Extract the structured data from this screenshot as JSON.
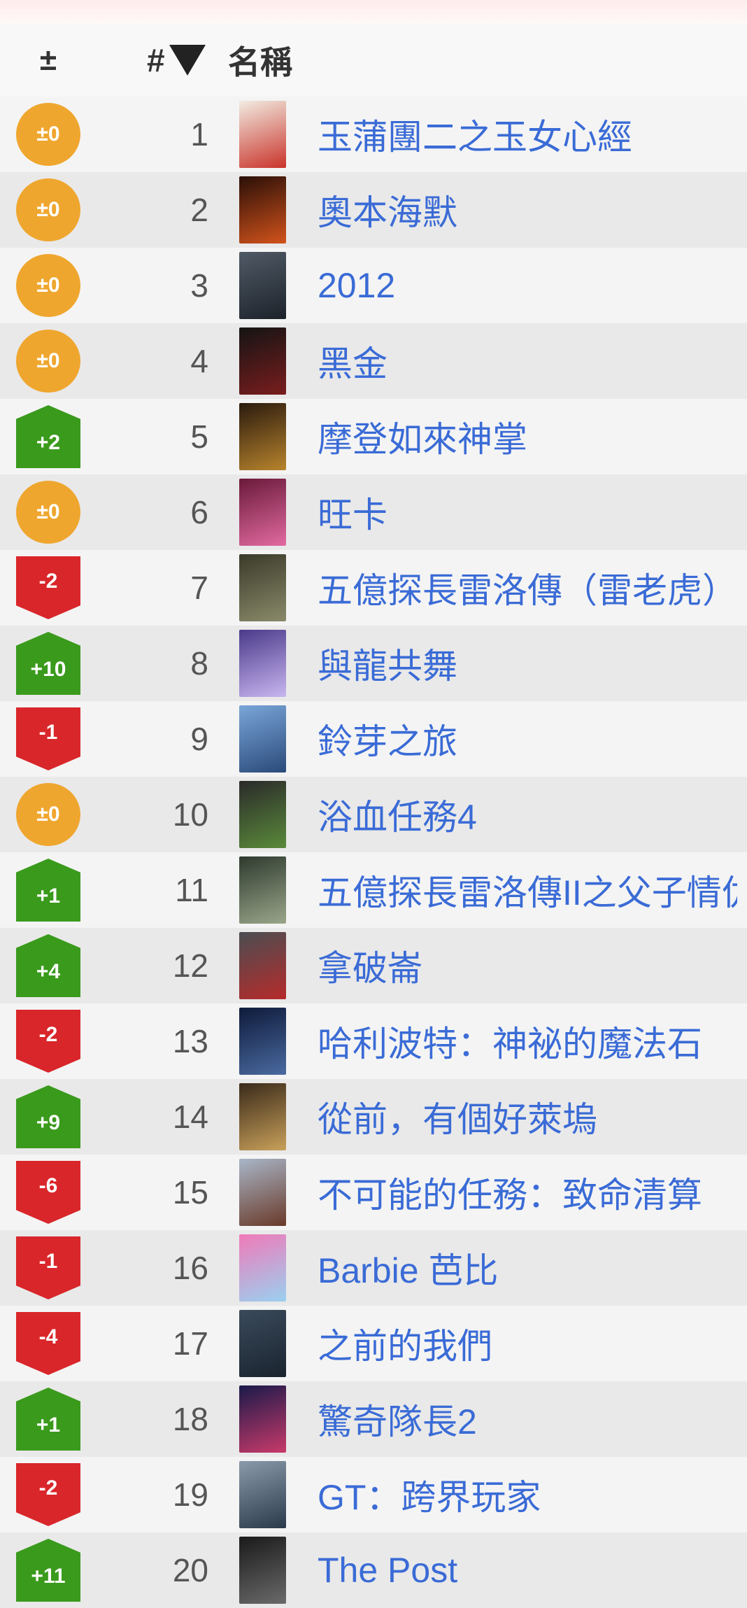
{
  "header": {
    "change_label": "±",
    "rank_label": "#",
    "name_label": "名稱"
  },
  "colors": {
    "same": "#efa62e",
    "up": "#3a9a1c",
    "down": "#d9262a",
    "link": "#3a6bd6"
  },
  "rows": [
    {
      "change": "±0",
      "dir": "same",
      "rank": "1",
      "title": "玉蒲團二之玉女心經",
      "poster": [
        "#f2ece2",
        "#c9332a"
      ]
    },
    {
      "change": "±0",
      "dir": "same",
      "rank": "2",
      "title": "奧本海默",
      "poster": [
        "#2a0f08",
        "#d2531b"
      ]
    },
    {
      "change": "±0",
      "dir": "same",
      "rank": "3",
      "title": "2012",
      "poster": [
        "#505a66",
        "#1c222a"
      ]
    },
    {
      "change": "±0",
      "dir": "same",
      "rank": "4",
      "title": "黑金",
      "poster": [
        "#141414",
        "#7a1d1d"
      ]
    },
    {
      "change": "+2",
      "dir": "up",
      "rank": "5",
      "title": "摩登如來神掌",
      "poster": [
        "#2a1a0e",
        "#b8842d"
      ]
    },
    {
      "change": "±0",
      "dir": "same",
      "rank": "6",
      "title": "旺卡",
      "poster": [
        "#6a1a3a",
        "#e16aa0"
      ]
    },
    {
      "change": "-2",
      "dir": "down",
      "rank": "7",
      "title": "五億探長雷洛傳（雷老虎）",
      "poster": [
        "#3a3a2a",
        "#8a8a6a"
      ]
    },
    {
      "change": "+10",
      "dir": "up",
      "rank": "8",
      "title": "與龍共舞",
      "poster": [
        "#4a3a8a",
        "#c8b6f0"
      ]
    },
    {
      "change": "-1",
      "dir": "down",
      "rank": "9",
      "title": "鈴芽之旅",
      "poster": [
        "#7aa6d8",
        "#2a4a7a"
      ]
    },
    {
      "change": "±0",
      "dir": "same",
      "rank": "10",
      "title": "浴血任務4",
      "poster": [
        "#2a2a2a",
        "#5a8a3a"
      ]
    },
    {
      "change": "+1",
      "dir": "up",
      "rank": "11",
      "title": "五億探長雷洛傳II之父子情仇",
      "poster": [
        "#2e3a2e",
        "#9aa68a"
      ]
    },
    {
      "change": "+4",
      "dir": "up",
      "rank": "12",
      "title": "拿破崙",
      "poster": [
        "#4a4e52",
        "#b62a2a"
      ]
    },
    {
      "change": "-2",
      "dir": "down",
      "rank": "13",
      "title": "哈利波特：神祕的魔法石",
      "poster": [
        "#0e1a3a",
        "#4a6aa0"
      ]
    },
    {
      "change": "+9",
      "dir": "up",
      "rank": "14",
      "title": "從前，有個好萊塢",
      "poster": [
        "#3a2a1a",
        "#c8a05a"
      ]
    },
    {
      "change": "-6",
      "dir": "down",
      "rank": "15",
      "title": "不可能的任務：致命清算",
      "poster": [
        "#a8b6c8",
        "#6a3a2a"
      ]
    },
    {
      "change": "-1",
      "dir": "down",
      "rank": "16",
      "title": "Barbie 芭比",
      "poster": [
        "#f07ab8",
        "#9ad0f0"
      ]
    },
    {
      "change": "-4",
      "dir": "down",
      "rank": "17",
      "title": "之前的我們",
      "poster": [
        "#3a4a5a",
        "#1a2430"
      ]
    },
    {
      "change": "+1",
      "dir": "up",
      "rank": "18",
      "title": "驚奇隊長2",
      "poster": [
        "#1a1a4a",
        "#c83a6a"
      ]
    },
    {
      "change": "-2",
      "dir": "down",
      "rank": "19",
      "title": "GT：跨界玩家",
      "poster": [
        "#8a9aaa",
        "#2a3a4a"
      ]
    },
    {
      "change": "+11",
      "dir": "up",
      "rank": "20",
      "title": "The Post",
      "poster": [
        "#1a1a1a",
        "#6a6a6a"
      ]
    }
  ]
}
